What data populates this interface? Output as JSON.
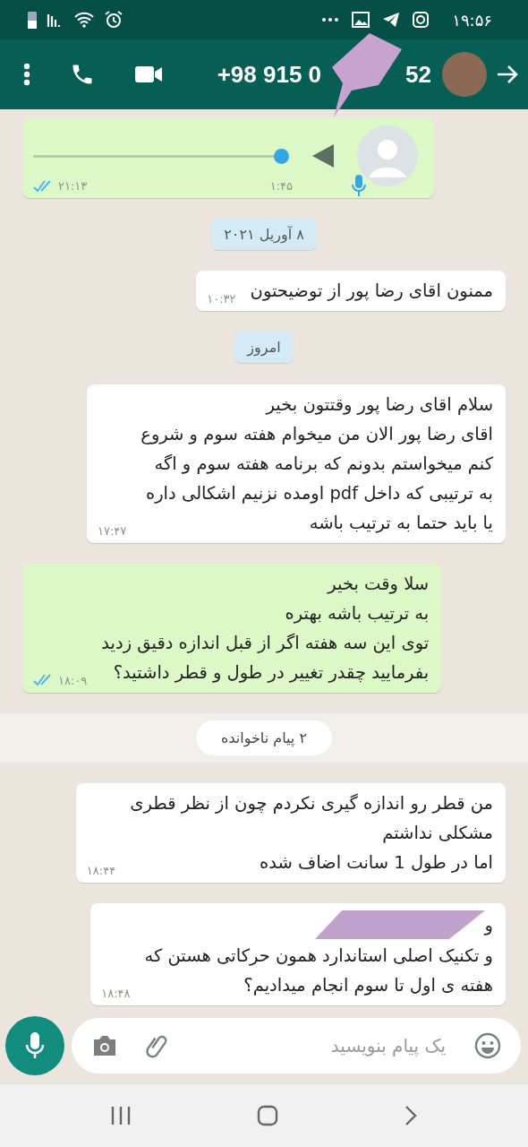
{
  "status_bar": {
    "time": "۱۹:۵۶"
  },
  "header": {
    "title_start": "+98 915 0",
    "title_end": "52",
    "redacted": true
  },
  "messages": [
    {
      "kind": "voice",
      "outgoing": true,
      "read": true,
      "time": "۲۱:۱۳",
      "duration": "۱:۴۵"
    },
    {
      "kind": "date",
      "text": "۸ آوریل ۲۰۲۱"
    },
    {
      "kind": "text",
      "outgoing": false,
      "text": "ممنون اقای رضا پور از توضیحتون",
      "time": "۱۰:۳۲"
    },
    {
      "kind": "date",
      "text": "امروز"
    },
    {
      "kind": "text",
      "outgoing": false,
      "text": "سلام اقای رضا پور وقتتون بخیر\nاقای رضا پور الان من میخوام هفته سوم و شروع\nکنم میخواستم بدونم که برنامه هفته سوم و اگه\nبه ترتیبی که داخل pdf اومده نزنیم اشکالی داره\nیا باید حتما به ترتیب باشه",
      "time": "۱۷:۴۷"
    },
    {
      "kind": "text",
      "outgoing": true,
      "read": true,
      "text": "سلا وقت بخیر\nبه ترتیب باشه بهتره\nتوی این سه هفته اگر از قبل اندازه دقیق زدید\nبفرمایید چقدر تغییر در طول و قطر داشتید؟",
      "time": "۱۸:۰۹"
    },
    {
      "kind": "unread",
      "text": "۲ پیام ناخوانده"
    },
    {
      "kind": "text",
      "outgoing": false,
      "text": "من قطر رو اندازه گیری نکردم چون از نظر قطری\nمشکلی نداشتم\nاما در طول 1  سانت اضاف شده",
      "time": "۱۸:۴۴"
    },
    {
      "kind": "text",
      "outgoing": false,
      "redacted": true,
      "hidden_line_start": "و",
      "text": "و تکنیک اصلی استاندارد همون حرکاتی هستن که\nهفته ی اول تا سوم انجام میدادیم؟",
      "time": "۱۸:۴۸"
    }
  ],
  "composer": {
    "placeholder": "یک پیام بنویسید"
  }
}
